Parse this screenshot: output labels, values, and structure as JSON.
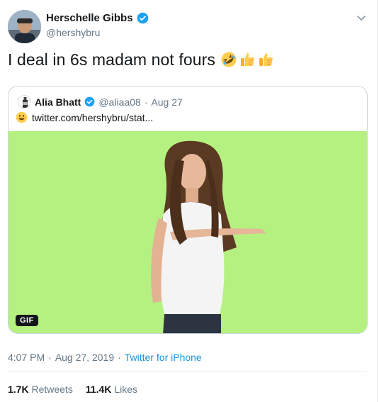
{
  "author": {
    "name": "Herschelle Gibbs",
    "handle": "@hershybru",
    "verified": true
  },
  "tweet_text": "I deal in 6s madam not fours",
  "emojis": [
    "rolling-on-floor-laughing",
    "thumbs-up",
    "thumbs-up"
  ],
  "quoted": {
    "name": "Alia Bhatt",
    "handle": "@aliaa08",
    "separator": "·",
    "date": "Aug 27",
    "link_text": "twitter.com/hershybru/stat...",
    "media_badge": "GIF"
  },
  "meta": {
    "time": "4:07 PM",
    "separator1": "·",
    "date": "Aug 27, 2019",
    "separator2": "·",
    "source": "Twitter for iPhone"
  },
  "stats": {
    "retweets_count": "1.7K",
    "retweets_label": "Retweets",
    "likes_count": "11.4K",
    "likes_label": "Likes"
  },
  "colors": {
    "accent": "#1da1f2",
    "gif_background": "#b5f180",
    "muted": "#657786"
  }
}
